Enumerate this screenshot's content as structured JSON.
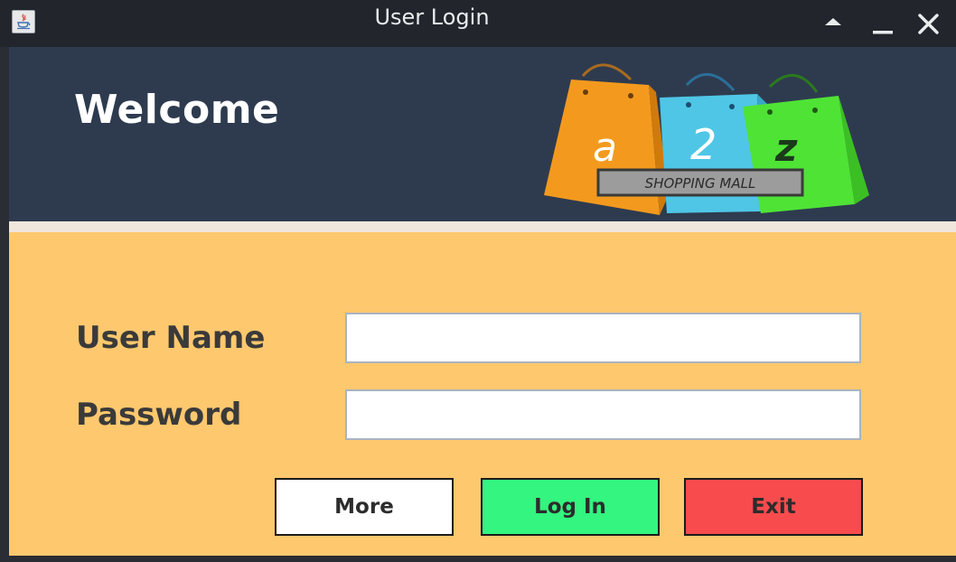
{
  "window": {
    "title": "User Login",
    "controls": {
      "up_icon": "triangle-up-icon",
      "minimize_icon": "minimize-icon",
      "close_icon": "close-icon"
    }
  },
  "header": {
    "welcome": "Welcome",
    "logo": {
      "letters": [
        "a",
        "2",
        "z"
      ],
      "tagline": "SHOPPING MALL"
    }
  },
  "form": {
    "username_label": "User Name",
    "password_label": "Password",
    "username_value": "",
    "password_value": ""
  },
  "buttons": {
    "more": "More",
    "login": "Log In",
    "exit": "Exit"
  },
  "colors": {
    "header_bg": "#2e3b4f",
    "form_bg": "#fdc86e",
    "login_button": "#33f57f",
    "exit_button": "#f84b4d",
    "more_button": "#ffffff"
  }
}
